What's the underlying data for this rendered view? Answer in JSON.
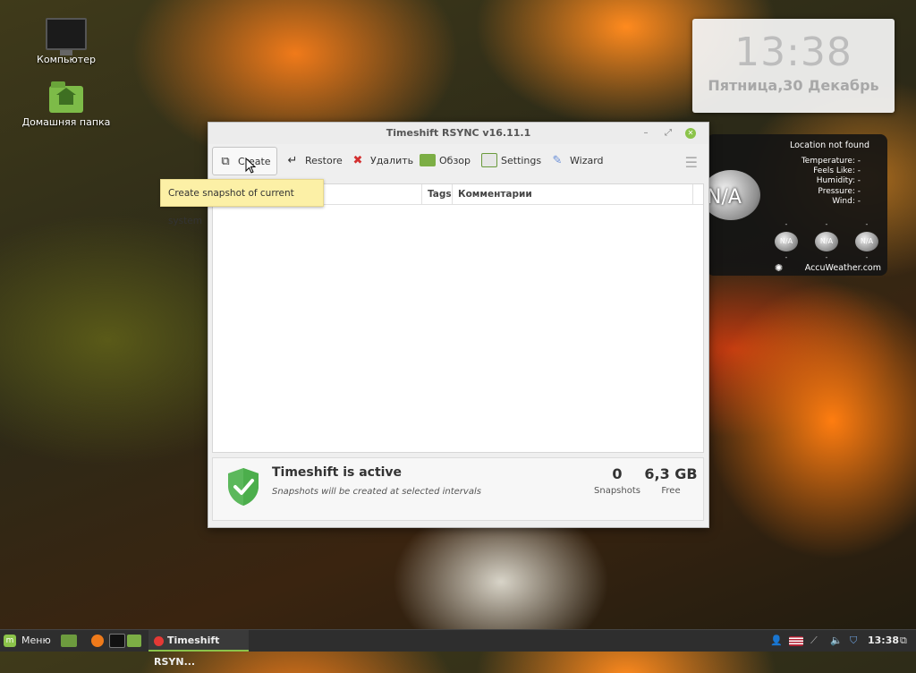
{
  "desktop": {
    "icons": [
      {
        "label": "Компьютер"
      },
      {
        "label": "Домашняя папка"
      }
    ]
  },
  "clock_widget": {
    "time": "13:38",
    "date": "Пятница,30 Декабрь"
  },
  "weather_widget": {
    "location": "Location not found",
    "rows": [
      "Temperature: -",
      "Feels Like: -",
      "Humidity: -",
      "Pressure: -",
      "Wind: -"
    ],
    "current": "N/A",
    "forecast": [
      {
        "top": "-",
        "icon": "N/A",
        "bottom": "-"
      },
      {
        "top": "-",
        "icon": "N/A",
        "bottom": "-"
      },
      {
        "top": "-",
        "icon": "N/A",
        "bottom": "-"
      }
    ],
    "provider": "AccuWeather.com"
  },
  "window": {
    "title": "Timeshift RSYNC v16.11.1",
    "toolbar": {
      "create": "Create",
      "restore": "Restore",
      "delete": "Удалить",
      "browse": "Обзор",
      "settings": "Settings",
      "wizard": "Wizard"
    },
    "tooltip": "Create snapshot of current system",
    "list": {
      "columns": [
        "Tags",
        "Комментарии"
      ]
    },
    "status": {
      "title": "Timeshift is active",
      "subtitle": "Snapshots will be created at selected intervals",
      "snapshots_count": "0",
      "snapshots_label": "Snapshots",
      "free_value": "6,3 GB",
      "free_label": "Free"
    }
  },
  "taskbar": {
    "menu_label": "Меню",
    "task_title": "Timeshift RSYN...",
    "time": "13:38"
  },
  "colors": {
    "accent_green": "#8bc34a",
    "tooltip_bg": "#fcf0a6",
    "taskbar_bg": "#2e2e2e"
  }
}
